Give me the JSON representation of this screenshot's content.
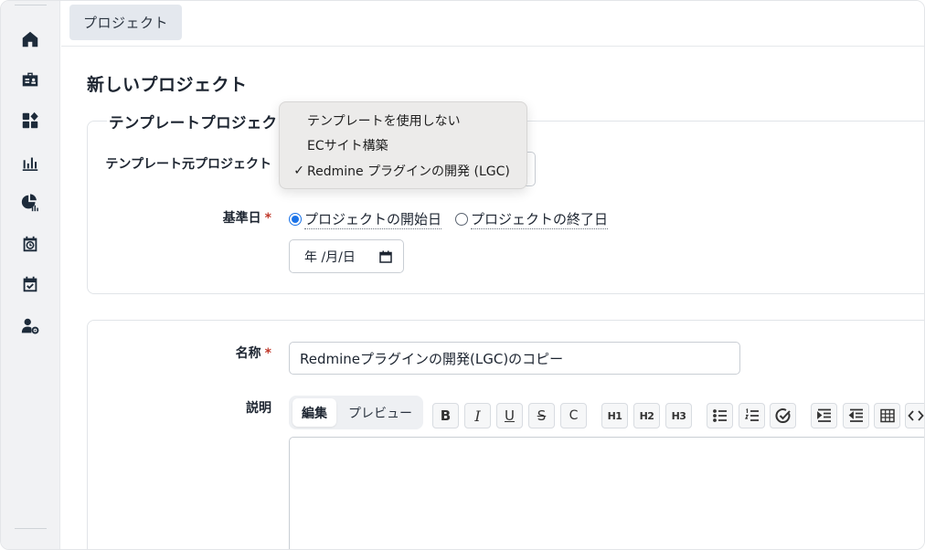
{
  "header": {
    "tab_label": "プロジェクト"
  },
  "page": {
    "title": "新しいプロジェクト"
  },
  "template_section": {
    "legend": "テンプレートプロジェク",
    "source_label": "テンプレート元プロジェクト",
    "base_date_label": "基準日",
    "required_mark": "*",
    "radio_start": "プロジェクトの開始日",
    "radio_end": "プロジェクトの終了日",
    "date_placeholder": "年 /月/日"
  },
  "dropdown": {
    "items": [
      {
        "label": "テンプレートを使用しない",
        "check": ""
      },
      {
        "label": "ECサイト構築",
        "check": ""
      },
      {
        "label": "Redmine プラグインの開発 (LGC)",
        "check": "✓"
      }
    ]
  },
  "form": {
    "name_label": "名称",
    "required_mark": "*",
    "name_value": "Redmineプラグインの開発(LGC)のコピー",
    "description_label": "説明",
    "edit_tab": "編集",
    "preview_tab": "プレビュー"
  },
  "toolbar": {
    "bold": "B",
    "italic": "I",
    "underline": "U",
    "strike": "S",
    "code": "C",
    "h1": "H1",
    "h2": "H2",
    "h3": "H3"
  },
  "sidebar_icons": [
    "home-icon",
    "briefcase-icon",
    "apps-icon",
    "chart-bar-icon",
    "pie-chart-icon",
    "calendar-clock-icon",
    "calendar-check-icon",
    "user-settings-icon"
  ]
}
